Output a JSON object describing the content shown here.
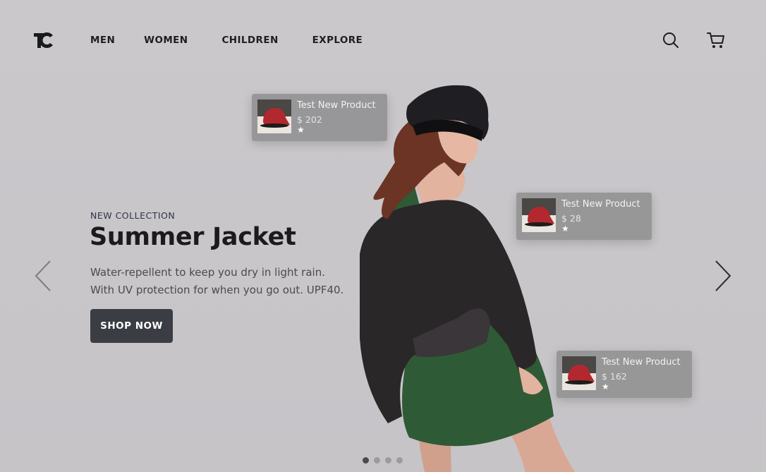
{
  "header": {
    "logo_text": "TC",
    "nav": [
      {
        "label": "MEN"
      },
      {
        "label": "WOMEN"
      },
      {
        "label": "CHILDREN"
      },
      {
        "label": "EXPLORE"
      }
    ],
    "icons": {
      "search": "search-icon",
      "cart": "cart-icon"
    }
  },
  "hero": {
    "eyebrow": "NEW COLLECTION",
    "title": "Summer Jacket",
    "description": "Water-repellent to keep you dry in light rain. With UV protection for when you go out. UPF40.",
    "cta_label": "SHOP NOW"
  },
  "products": [
    {
      "name": "Test New Product",
      "price": "$ 202",
      "rating": "★"
    },
    {
      "name": "Test New Product",
      "price": "$ 28",
      "rating": "★"
    },
    {
      "name": "Test New Product",
      "price": "$ 162",
      "rating": "★"
    }
  ],
  "carousel": {
    "slides": 4,
    "active": 1
  },
  "colors": {
    "background": "#c9c7ca",
    "button": "#3b3d44",
    "card": "#8c8c8e",
    "jacket": "#2a2729",
    "dress": "#2f5a36",
    "cap_red": "#b3282f"
  }
}
